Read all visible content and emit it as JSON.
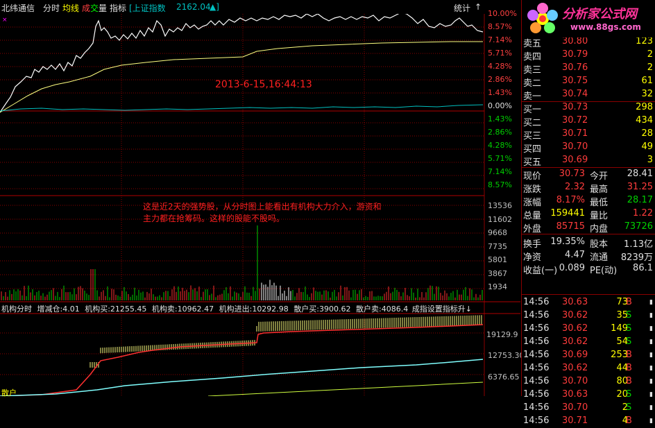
{
  "toolbar": {
    "stock_name": "北纬通信",
    "mode": "分时",
    "avg_line": "均线",
    "vol_cheng": "成",
    "vol_jiao": "交",
    "vol_liang": "量",
    "indicator": "指标",
    "index_name": "[上证指数",
    "index_value": "2162.04",
    "index_arrow": "▲]",
    "stats": "统计",
    "arrow": "↑"
  },
  "pct_axis_right": [
    "10.00%",
    "8.57%",
    "7.14%",
    "5.71%",
    "4.28%",
    "2.86%",
    "1.43%",
    "0.00%",
    "1.43%",
    "2.86%",
    "4.28%",
    "5.71%",
    "7.14%",
    "8.57%"
  ],
  "vol_axis_right": [
    "13536",
    "11602",
    "9668",
    "7735",
    "5801",
    "3867",
    "1934"
  ],
  "lower_axis_right": [
    "19129.9",
    "12753.30",
    "6376.65"
  ],
  "timestamp_text": "2013-6-15,16:44:13",
  "annotation_line1": "这是近2天的强势股，从分时图上能看出有机构大力介入，游资和",
  "annotation_line2": "主力都在抢筹码。这样的股能不股吗。",
  "indicator_bar": {
    "name": "机构分时",
    "zjc": "增减仓:4.01",
    "jgm": "机构买:21255.45",
    "jgs": "机构卖:10962.47",
    "jgjc": "机构进出:10292.98",
    "shm": "散户买:3900.62",
    "shs": "散户卖:4086.4",
    "overlap": "成指设置指标升↓",
    "bottom_label": "散户"
  },
  "logo": {
    "title": "分析家公式网",
    "url": "www.88gs.com"
  },
  "orderbook": {
    "sells": [
      {
        "label": "卖五",
        "price": "30.80",
        "vol": "123"
      },
      {
        "label": "卖四",
        "price": "30.79",
        "vol": "2"
      },
      {
        "label": "卖三",
        "price": "30.76",
        "vol": "2"
      },
      {
        "label": "卖二",
        "price": "30.75",
        "vol": "61"
      },
      {
        "label": "卖一",
        "price": "30.74",
        "vol": "32"
      }
    ],
    "buys": [
      {
        "label": "买一",
        "price": "30.73",
        "vol": "298"
      },
      {
        "label": "买二",
        "price": "30.72",
        "vol": "434"
      },
      {
        "label": "买三",
        "price": "30.71",
        "vol": "28"
      },
      {
        "label": "买四",
        "price": "30.70",
        "vol": "49"
      },
      {
        "label": "买五",
        "price": "30.69",
        "vol": "3"
      }
    ]
  },
  "quote": {
    "xj_l": "现价",
    "xj": "30.73",
    "jk_l": "今开",
    "jk": "28.41",
    "zd_l": "涨跌",
    "zd": "2.32",
    "zg_l": "最高",
    "zg": "31.25",
    "zf_l": "涨幅",
    "zf": "8.17%",
    "zdi_l": "最低",
    "zdi": "28.17",
    "zl_l": "总量",
    "zl": "159441",
    "lb_l": "量比",
    "lb": "1.22",
    "wp_l": "外盘",
    "wp": "85715",
    "np_l": "内盘",
    "np": "73726",
    "hs_l": "换手",
    "hs": "19.35%",
    "gb_l": "股本",
    "gb": "1.13亿",
    "jz_l": "净资",
    "jz": "4.47",
    "lt_l": "流通",
    "lt": "8239万",
    "sy_l": "收益(一)",
    "sy": "0.089",
    "pe_l": "PE(动)",
    "pe": "86.1"
  },
  "ticks": [
    {
      "t": "14:56",
      "p": "30.63",
      "v": "73",
      "s": "B"
    },
    {
      "t": "14:56",
      "p": "30.62",
      "v": "35",
      "s": "S"
    },
    {
      "t": "14:56",
      "p": "30.62",
      "v": "149",
      "s": "S"
    },
    {
      "t": "14:56",
      "p": "30.62",
      "v": "54",
      "s": "S"
    },
    {
      "t": "14:56",
      "p": "30.69",
      "v": "253",
      "s": "B"
    },
    {
      "t": "14:56",
      "p": "30.62",
      "v": "44",
      "s": "B"
    },
    {
      "t": "14:56",
      "p": "30.70",
      "v": "80",
      "s": "B"
    },
    {
      "t": "14:56",
      "p": "30.63",
      "v": "20",
      "s": "S"
    },
    {
      "t": "14:56",
      "p": "30.70",
      "v": "2",
      "s": "S"
    },
    {
      "t": "14:56",
      "p": "30.71",
      "v": "4",
      "s": "B"
    }
  ]
}
